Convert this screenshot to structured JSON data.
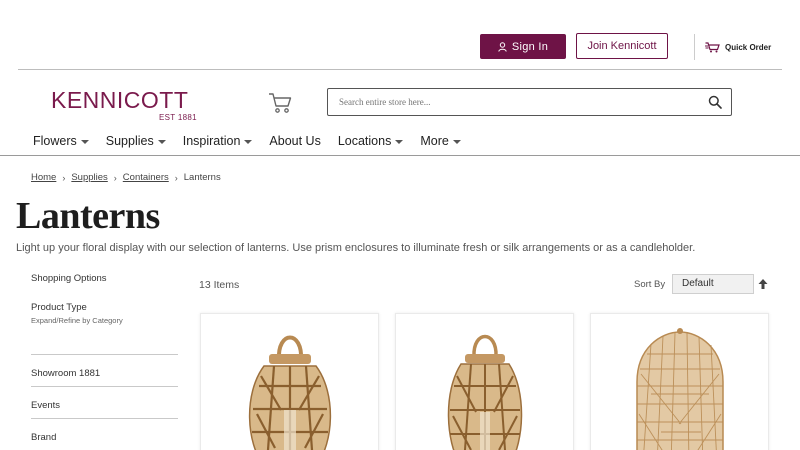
{
  "header": {
    "sign_in_label": "Sign In",
    "join_label": "Join Kennicott",
    "quick_order_label": "Quick Order"
  },
  "logo": {
    "name": "KENNICOTT",
    "tagline": "EST 1881"
  },
  "search": {
    "placeholder": "Search entire store here..."
  },
  "nav": {
    "items": [
      {
        "label": "Flowers",
        "has_dropdown": true
      },
      {
        "label": "Supplies",
        "has_dropdown": true
      },
      {
        "label": "Inspiration",
        "has_dropdown": true
      },
      {
        "label": "About Us",
        "has_dropdown": false
      },
      {
        "label": "Locations",
        "has_dropdown": true
      },
      {
        "label": "More",
        "has_dropdown": true
      }
    ]
  },
  "breadcrumb": [
    "Home",
    "Supplies",
    "Containers",
    "Lanterns"
  ],
  "page": {
    "title": "Lanterns",
    "description": "Light up your floral display with our selection of lanterns. Use prism enclosures to illuminate fresh or silk arrangements or as a candleholder."
  },
  "sidebar": {
    "heading": "Shopping Options",
    "product_type": "Product Type",
    "product_type_sub": "Expand/Refine by Category",
    "items": [
      "Showroom 1881",
      "Events",
      "Brand"
    ]
  },
  "toolbar": {
    "items_count": "13 Items",
    "sort_label": "Sort By",
    "sort_value": "Default"
  },
  "products": [
    {
      "image": "rattan-lantern-tall-handle"
    },
    {
      "image": "rattan-lantern-small-handle"
    },
    {
      "image": "rattan-birdcage-lantern"
    }
  ],
  "colors": {
    "brand": "#7a1a4c",
    "button": "#6e1346",
    "rattan": "#b88a52"
  }
}
